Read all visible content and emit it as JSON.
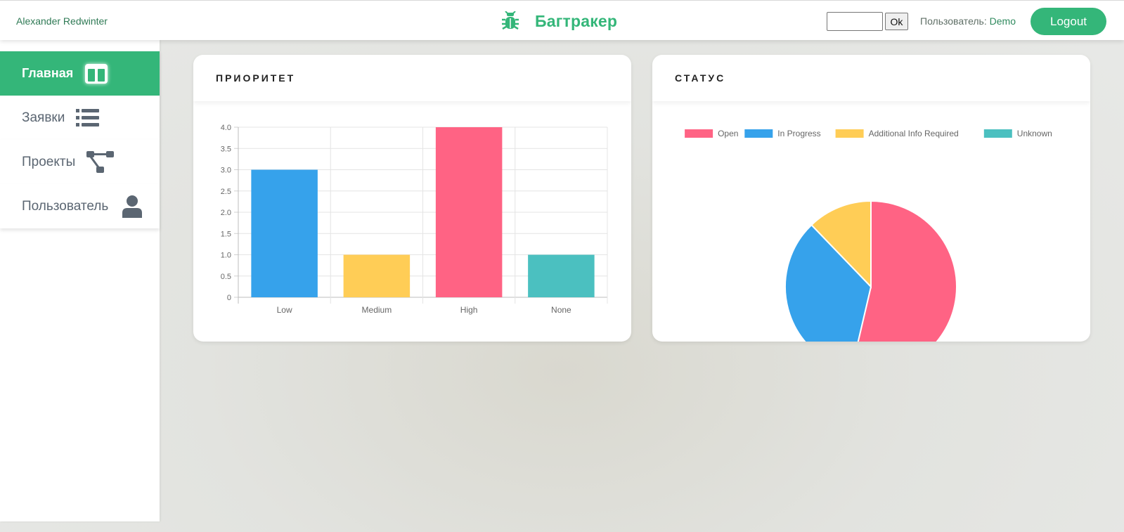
{
  "header": {
    "author": "Alexander Redwinter",
    "title": "Багтракер",
    "search": {
      "value": "",
      "placeholder": ""
    },
    "ok_label": "Ok",
    "user_prefix": "Пользователь:",
    "user_name": "Demo",
    "logout_label": "Logout"
  },
  "sidebar": {
    "items": [
      {
        "label": "Главная",
        "icon": "dashboard-icon",
        "active": true
      },
      {
        "label": "Заявки",
        "icon": "list-icon",
        "active": false
      },
      {
        "label": "Проекты",
        "icon": "project-tree-icon",
        "active": false
      },
      {
        "label": "Пользователь",
        "icon": "user-icon",
        "active": false
      }
    ]
  },
  "colors": {
    "accent": "#34b679",
    "pink": "#ff6384",
    "blue": "#36a2eb",
    "yellow": "#ffcd56",
    "teal": "#4bc0c0"
  },
  "cards": {
    "priority_title": "ПРИОРИТЕТ",
    "status_title": "СТАТУС"
  },
  "chart_data": [
    {
      "type": "bar",
      "categories": [
        "Low",
        "Medium",
        "High",
        "None"
      ],
      "values": [
        3,
        1,
        4,
        1
      ],
      "colors": [
        "#36a2eb",
        "#ffcd56",
        "#ff6384",
        "#4bc0c0"
      ],
      "ylim": [
        0,
        4
      ],
      "yticks": [
        "0",
        "0.5",
        "1.0",
        "1.5",
        "2.0",
        "2.5",
        "3.0",
        "3.5",
        "4.0"
      ],
      "grid": true
    },
    {
      "type": "pie",
      "labels": [
        "Open",
        "In Progress",
        "Additional Info Required",
        "Unknown"
      ],
      "values": [
        5.5,
        3.5,
        1.25,
        0
      ],
      "colors": [
        "#ff6384",
        "#36a2eb",
        "#ffcd56",
        "#4bc0c0"
      ],
      "legend": "top"
    }
  ]
}
